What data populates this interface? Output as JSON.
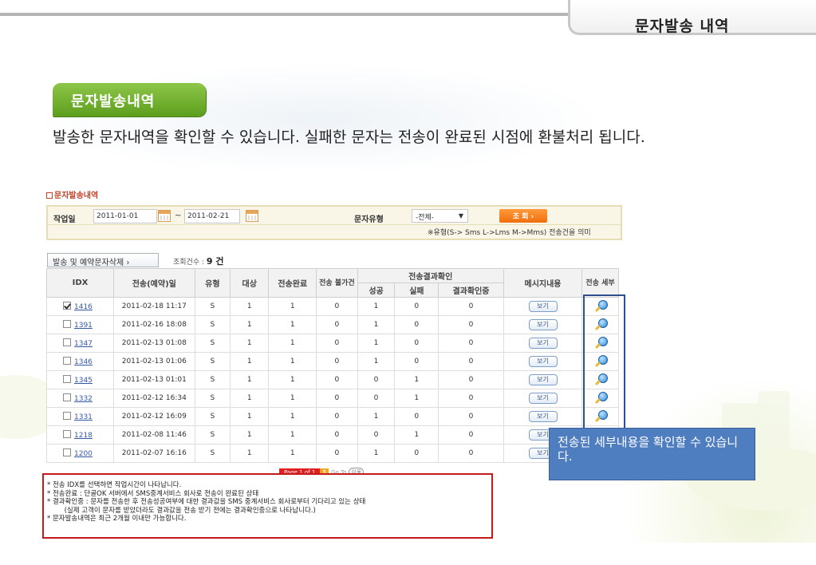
{
  "header": {
    "title": "문자발송 내역"
  },
  "badge": {
    "label": "문자발송내역"
  },
  "description": "발송한 문자내역을 확인할 수 있습니다. 실패한 문자는 전송이 완료된 시점에 환불처리 됩니다.",
  "section_title": "문자발송내역",
  "search": {
    "work_date_label": "작업일",
    "date_from": "2011-01-01",
    "tilde": "~",
    "date_to": "2011-02-21",
    "type_label": "문자유형",
    "type_value": "-전체-",
    "search_button": "조 회 ›",
    "note": "※유형(S-> Sms L->Lms M->Mms) 전송건을 의미"
  },
  "actions": {
    "delete_button": "발송 및 예약문자삭제 ›",
    "count_label": "조회건수 :",
    "count_value": "9 건"
  },
  "table": {
    "headers": {
      "idx": "IDX",
      "date": "전송(예약)일",
      "type": "유형",
      "target": "대상",
      "done": "전송완료",
      "unsendable": "전송 불가건",
      "result_group": "전송결과확인",
      "success": "성공",
      "fail": "실패",
      "checking": "결과확인중",
      "message": "메시지내용",
      "detail": "전송 세부"
    },
    "view_label": "보기",
    "rows": [
      {
        "idx": "1416",
        "date": "2011-02-18 11:17",
        "type": "S",
        "target": "1",
        "done": "1",
        "unsendable": "0",
        "success": "1",
        "fail": "0",
        "checking": "0",
        "checked": true
      },
      {
        "idx": "1391",
        "date": "2011-02-16 18:08",
        "type": "S",
        "target": "1",
        "done": "1",
        "unsendable": "0",
        "success": "1",
        "fail": "0",
        "checking": "0",
        "checked": false
      },
      {
        "idx": "1347",
        "date": "2011-02-13 01:08",
        "type": "S",
        "target": "1",
        "done": "1",
        "unsendable": "0",
        "success": "1",
        "fail": "0",
        "checking": "0",
        "checked": false
      },
      {
        "idx": "1346",
        "date": "2011-02-13 01:06",
        "type": "S",
        "target": "1",
        "done": "1",
        "unsendable": "0",
        "success": "1",
        "fail": "0",
        "checking": "0",
        "checked": false
      },
      {
        "idx": "1345",
        "date": "2011-02-13 01:01",
        "type": "S",
        "target": "1",
        "done": "1",
        "unsendable": "0",
        "success": "0",
        "fail": "1",
        "checking": "0",
        "checked": false
      },
      {
        "idx": "1332",
        "date": "2011-02-12 16:34",
        "type": "S",
        "target": "1",
        "done": "1",
        "unsendable": "0",
        "success": "0",
        "fail": "1",
        "checking": "0",
        "checked": false
      },
      {
        "idx": "1331",
        "date": "2011-02-12 16:09",
        "type": "S",
        "target": "1",
        "done": "1",
        "unsendable": "0",
        "success": "1",
        "fail": "0",
        "checking": "0",
        "checked": false
      },
      {
        "idx": "1218",
        "date": "2011-02-08 11:46",
        "type": "S",
        "target": "1",
        "done": "1",
        "unsendable": "0",
        "success": "0",
        "fail": "1",
        "checking": "0",
        "checked": false
      },
      {
        "idx": "1200",
        "date": "2011-02-07 16:16",
        "type": "S",
        "target": "1",
        "done": "1",
        "unsendable": "0",
        "success": "1",
        "fail": "0",
        "checking": "0",
        "checked": false
      }
    ]
  },
  "pager": {
    "page_text": "Page 1 of 1",
    "current": "1",
    "go_to": "Go To",
    "go_btn": "이동"
  },
  "notes": [
    "* 전송 IDX를 선택하면 작업시간이 나타납니다.",
    "* 전송완료 : 단골OK 서버에서 SMS중계서비스 회사로 전송이 완료된 상태",
    "* 결과확인중 : 문자를 전송한 후 전송성공여부에 대한 결과값을 SMS 중계서비스 회사로부터 기다리고 있는 상태",
    "        (실제 고객이 문자를 받았더라도 결과값을 전송 받기 전에는 결과확인중으로 나타납니다.)",
    "* 문자발송내역은 최근 2개월 이내만 가능합니다."
  ],
  "callout": "전송된 세부내용을 확인할 수 있습니다.",
  "colors": {
    "badge_green": "#6aab2a",
    "callout_blue": "#4f7ec0",
    "notes_border": "#c41a1a",
    "search_orange": "#f07a18"
  }
}
